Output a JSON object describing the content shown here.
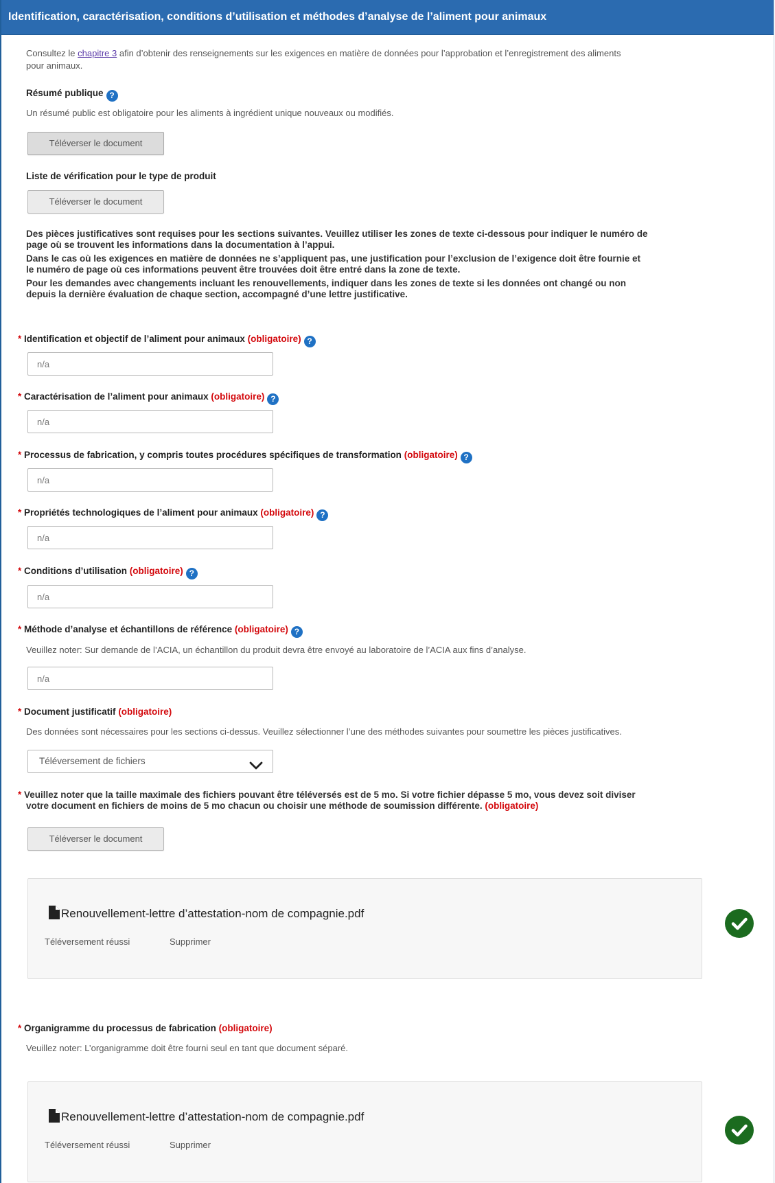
{
  "header": {
    "title": "Identification, caractérisation, conditions d’utilisation et méthodes d’analyse de l’aliment pour animaux"
  },
  "intro": {
    "prefix": "Consultez le ",
    "link": "chapitre 3",
    "suffix_line1": " afin d’obtenir des renseignements sur les exigences en matière de données pour l’approbation et l’enregistrement des aliments",
    "suffix_line2": "pour animaux."
  },
  "resume": {
    "label": "Résumé publique",
    "help": "?",
    "note": "Un résumé public est obligatoire pour les aliments à ingrédient unique nouveaux ou modifiés.",
    "button": "Téléverser le document"
  },
  "checklist": {
    "label": "Liste de vérification pour le type de produit",
    "button": "Téléverser le document"
  },
  "instructions": {
    "p1_l1": "Des pièces justificatives sont requises pour les sections suivantes. Veuillez utiliser les zones de texte ci-dessous pour indiquer le numéro de",
    "p1_l2": "page où se trouvent les informations dans la documentation à l’appui.",
    "p2_l1": "Dans le cas où les exigences en matière de données ne s’appliquent pas, une justification pour l’exclusion de l’exigence doit être fournie et",
    "p2_l2": "le numéro de page où ces informations peuvent être trouvées doit être entré dans la zone de texte.",
    "p3_l1": "Pour les demandes avec changements incluant les renouvellements, indiquer dans les zones de texte si les données ont changé ou non",
    "p3_l2": "depuis la dernière évaluation de chaque section, accompagné d’une lettre justificative."
  },
  "required_star": "*",
  "required_word": "(obligatoire)",
  "fields": [
    {
      "label": "Identification et objectif de l’aliment pour animaux",
      "value": "n/a"
    },
    {
      "label": "Caractérisation de l’aliment pour animaux",
      "value": "n/a"
    },
    {
      "label": "Processus de fabrication, y compris toutes procédures spécifiques de transformation",
      "value": "n/a"
    },
    {
      "label": "Propriétés technologiques de l’aliment pour animaux",
      "value": "n/a"
    },
    {
      "label": "Conditions d’utilisation",
      "value": "n/a"
    },
    {
      "label": "Méthode d’analyse et échantillons de référence",
      "value": "n/a",
      "note": "Veuillez noter: Sur demande de l’ACIA, un échantillon du produit devra être envoyé au laboratoire de l’ACIA aux fins d’analyse."
    }
  ],
  "document": {
    "label": "Document justificatif",
    "note": "Des données sont nécessaires pour les sections ci-dessus. Veuillez sélectionner l’une des méthodes suivantes pour soumettre les pièces justificatives.",
    "select_value": "Téléversement de fichiers"
  },
  "size_note": {
    "l1": "Veuillez noter que la taille maximale des fichiers pouvant être téléversés est de 5 mo.  Si votre fichier dépasse 5 mo, vous devez soit diviser",
    "l2": "votre document en fichiers de moins de 5 mo chacun ou choisir une méthode de soumission différente.",
    "button": "Téléverser le document"
  },
  "file1": {
    "name": "Renouvellement-lettre d’attestation-nom de compagnie.pdf",
    "status": "Téléversement réussi",
    "action": "Supprimer"
  },
  "organigramme": {
    "label": "Organigramme du processus de fabrication",
    "note": "Veuillez noter: L’organigramme doit être fourni seul en tant que document séparé."
  },
  "file2": {
    "name": "Renouvellement-lettre d’attestation-nom de compagnie.pdf",
    "status": "Téléversement réussi",
    "action": "Supprimer"
  },
  "colors": {
    "header": "#2b6bb0",
    "required": "#d3080c",
    "help": "#1f71c4",
    "success": "#1b6b1f"
  }
}
